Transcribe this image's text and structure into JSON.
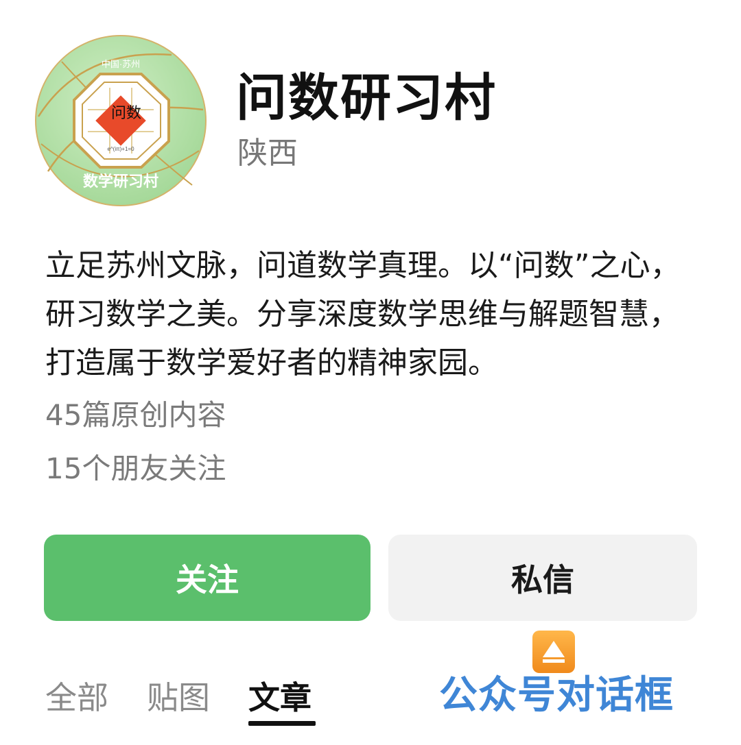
{
  "profile": {
    "avatar_ring_top": "中国·苏州",
    "avatar_seal_text": "问数",
    "avatar_ring_bottom": "数学研习村",
    "avatar_formula": "e^(iπ)+1=0",
    "name": "问数研习村",
    "region": "陕西",
    "description": "立足苏州文脉，问道数学真理。以“问数”之心，研习数学之美。分享深度数学思维与解题智慧，打造属于数学爱好者的精神家园。",
    "stats": {
      "articles": "45篇原创内容",
      "friends": "15个朋友关注"
    }
  },
  "actions": {
    "follow_label": "关注",
    "message_label": "私信"
  },
  "tabs": [
    {
      "label": "全部",
      "active": false
    },
    {
      "label": "贴图",
      "active": false
    },
    {
      "label": "文章",
      "active": true
    }
  ],
  "annotation": {
    "icon": "up-arrow-icon",
    "text": "公众号对话框"
  },
  "colors": {
    "accent": "#5bbf6c",
    "annotation_text": "#3f86d6",
    "annotation_icon": "#f29a2e"
  }
}
